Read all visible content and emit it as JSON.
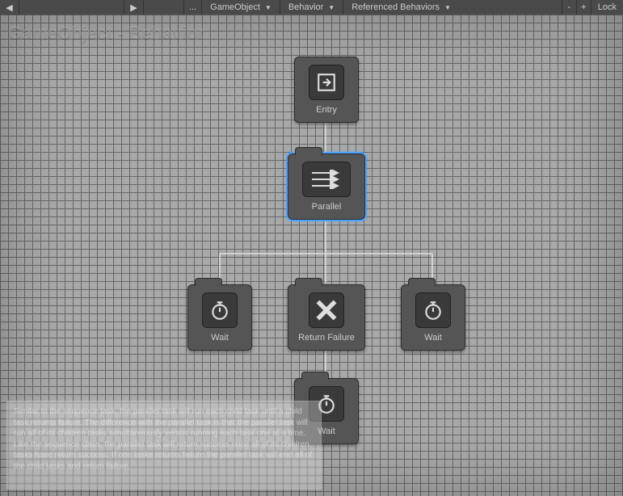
{
  "toolbar": {
    "ellipsis": "...",
    "gameobject": "GameObject",
    "behavior": "Behavior",
    "referenced": "Referenced Behaviors",
    "minus": "-",
    "plus": "+",
    "lock": "Lock"
  },
  "breadcrumb": "GameObject - Behavior",
  "nodes": {
    "entry": {
      "label": "Entry"
    },
    "parallel": {
      "label": "Parallel"
    },
    "wait1": {
      "label": "Wait"
    },
    "returnFailure": {
      "label": "Return Failure"
    },
    "wait2": {
      "label": "Wait"
    },
    "wait3": {
      "label": "Wait"
    }
  },
  "tooltip": "Similar to the sequence task, the parallel task will run each child task until a child task returns failure. The difference with the parallel task is that the parallel task will run all of its children tasks simultaneously versus running each task one at a time. Like the sequence class, the parallel task will return success once all of its children tasks have return success. If one tasks returns failure the parallel task will end all of the child tasks and return failure."
}
